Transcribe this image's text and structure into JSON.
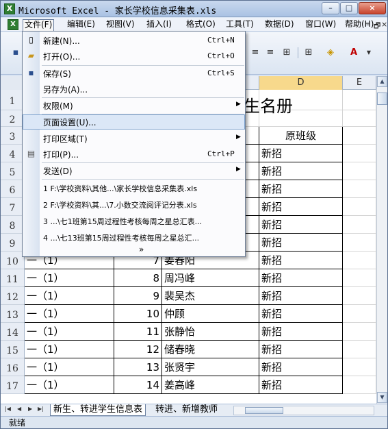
{
  "window": {
    "title": "Microsoft Excel - 家长学校信息采集表.xls",
    "min": "–",
    "max": "□",
    "close": "×"
  },
  "menubar": {
    "items": [
      "文件(F)",
      "编辑(E)",
      "视图(V)",
      "插入(I)",
      "格式(O)",
      "工具(T)",
      "数据(D)",
      "窗口(W)",
      "帮助(H)"
    ],
    "mdi_controls": [
      "–",
      "🗗",
      "×"
    ]
  },
  "file_menu": {
    "items": [
      {
        "label": "新建(N)...",
        "shortcut": "Ctrl+N",
        "icon": "new-document-icon"
      },
      {
        "label": "打开(O)...",
        "shortcut": "Ctrl+O",
        "icon": "open-folder-icon"
      },
      {
        "label": "保存(S)",
        "shortcut": "Ctrl+S",
        "icon": "save-icon"
      },
      {
        "label": "另存为(A)...",
        "shortcut": ""
      },
      {
        "label": "权限(M)",
        "shortcut": "",
        "submenu": true
      },
      {
        "label": "页面设置(U)...",
        "shortcut": "",
        "highlighted": true
      },
      {
        "label": "打印区域(T)",
        "shortcut": "",
        "submenu": true
      },
      {
        "label": "打印(P)...",
        "shortcut": "Ctrl+P",
        "icon": "printer-icon"
      },
      {
        "label": "发送(D)",
        "shortcut": "",
        "submenu": true
      }
    ],
    "recent_files": [
      "1 F:\\学校资料\\其他...\\家长学校信息采集表.xls",
      "2 F:\\学校资料\\其...\\7.小数交流阅评记分表.xls",
      "3 ...\\七1班第15周过程性考核每周之星总汇表...",
      "4 ...\\七13班第15周过程性考核每周之星总汇..."
    ],
    "more_glyph": "»"
  },
  "grid": {
    "columns": [
      "D",
      "E"
    ],
    "title_fragment": "生名册",
    "header_cell": "原班级",
    "rows": [
      {
        "num": "1",
        "a": "",
        "b": "",
        "c": "",
        "d": ""
      },
      {
        "num": "2",
        "a": "",
        "b": "",
        "c": "",
        "d": ""
      },
      {
        "num": "3",
        "a": "",
        "b": "",
        "c": "",
        "d": "原班级"
      },
      {
        "num": "4",
        "a": "",
        "b": "",
        "c": "",
        "d": "新招"
      },
      {
        "num": "5",
        "a": "",
        "b": "",
        "c": "",
        "d": "新招"
      },
      {
        "num": "6",
        "a": "",
        "b": "",
        "c": "",
        "d": "新招"
      },
      {
        "num": "7",
        "a": "",
        "b": "",
        "c": "",
        "d": "新招"
      },
      {
        "num": "8",
        "a": "",
        "b": "",
        "c": "",
        "d": "新招"
      },
      {
        "num": "9",
        "a": "",
        "b": "",
        "c": "",
        "d": "新招"
      },
      {
        "num": "10",
        "a": "一（1）",
        "b": "7",
        "c": "姜春阳",
        "d": "新招"
      },
      {
        "num": "11",
        "a": "一（1）",
        "b": "8",
        "c": "周冯峰",
        "d": "新招"
      },
      {
        "num": "12",
        "a": "一（1）",
        "b": "9",
        "c": "裴吴杰",
        "d": "新招"
      },
      {
        "num": "13",
        "a": "一（1）",
        "b": "10",
        "c": "仲顾",
        "d": "新招"
      },
      {
        "num": "14",
        "a": "一（1）",
        "b": "11",
        "c": "张静怡",
        "d": "新招"
      },
      {
        "num": "15",
        "a": "一（1）",
        "b": "12",
        "c": "储春晓",
        "d": "新招"
      },
      {
        "num": "16",
        "a": "一（1）",
        "b": "13",
        "c": "张贤宇",
        "d": "新招"
      },
      {
        "num": "17",
        "a": "一（1）",
        "b": "14",
        "c": "姜高峰",
        "d": "新招"
      }
    ]
  },
  "sheets": {
    "tabs": [
      "新生、转进学生信息表",
      "转进、新增教师"
    ]
  },
  "status": {
    "text": "就绪"
  }
}
